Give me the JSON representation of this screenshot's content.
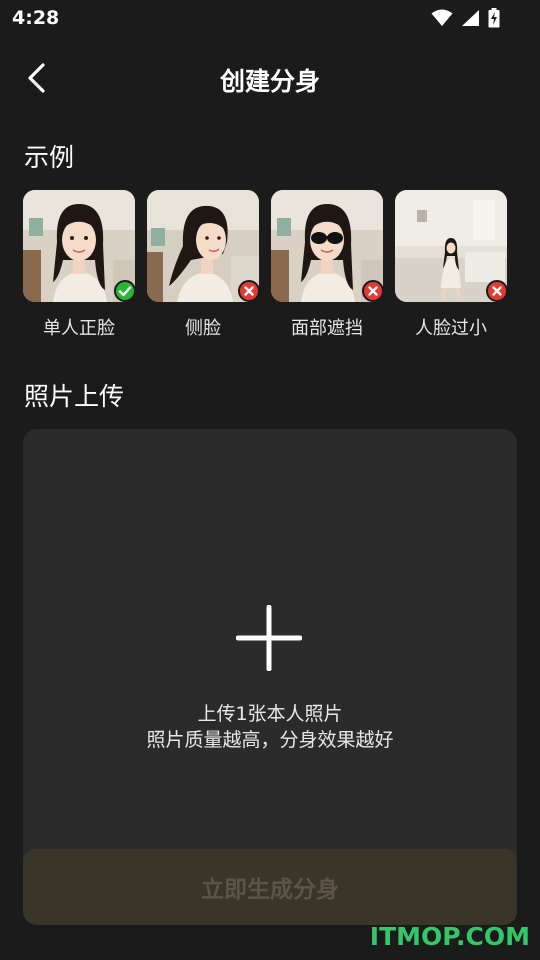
{
  "status_bar": {
    "time": "4:28",
    "icons": [
      "wifi-icon",
      "cellular-signal-icon",
      "battery-charging-icon"
    ]
  },
  "header": {
    "title": "创建分身",
    "back_icon": "chevron-left-icon"
  },
  "examples": {
    "section_title": "示例",
    "items": [
      {
        "label": "单人正脸",
        "status": "valid",
        "badge_icon": "check-icon",
        "badge_color": "#2bb534"
      },
      {
        "label": "侧脸",
        "status": "invalid",
        "badge_icon": "close-icon",
        "badge_color": "#e53935"
      },
      {
        "label": "面部遮挡",
        "status": "invalid",
        "badge_icon": "close-icon",
        "badge_color": "#e53935"
      },
      {
        "label": "人脸过小",
        "status": "invalid",
        "badge_icon": "close-icon",
        "badge_color": "#e53935"
      }
    ]
  },
  "upload": {
    "section_title": "照片上传",
    "plus_icon": "plus-icon",
    "hint_line1": "上传1张本人照片",
    "hint_line2": "照片质量越高，分身效果越好",
    "button_label": "立即生成分身"
  },
  "watermark": "ITMOP.COM",
  "colors": {
    "background": "#1b1b1b",
    "card": "#2b2b2b",
    "button_bg": "#3a3529",
    "button_text": "#5c5444",
    "valid": "#2bb534",
    "invalid": "#e53935",
    "watermark": "#35c66a"
  }
}
